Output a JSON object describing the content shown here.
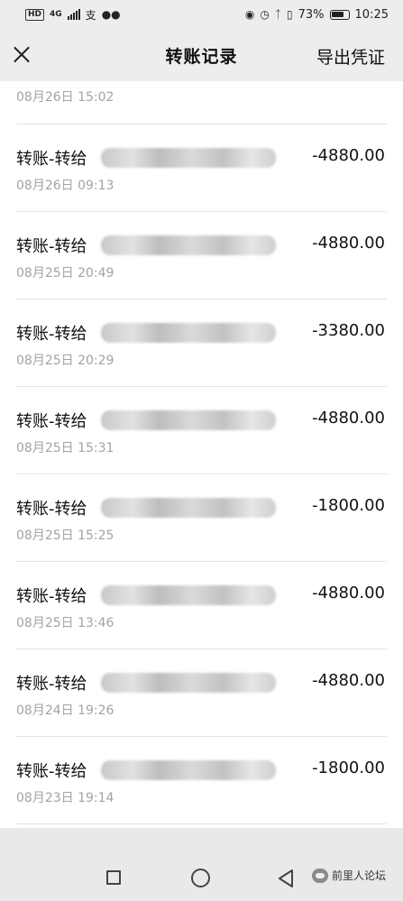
{
  "status_bar": {
    "network": "HD",
    "network_gen": "4G",
    "battery_percent": "73%",
    "time": "10:25",
    "icons": [
      "hd-icon",
      "signal-icon",
      "alipay-icon",
      "wechat-icon",
      "eye-icon",
      "alarm-icon",
      "bluetooth-icon",
      "vibrate-icon",
      "battery-icon"
    ]
  },
  "nav": {
    "title": "转账记录",
    "export_label": "导出凭证",
    "close_icon": "close-icon"
  },
  "transactions": [
    {
      "title": "",
      "time": "08月26日 15:02",
      "amount": ""
    },
    {
      "title": "转账-转给",
      "time": "08月26日 09:13",
      "amount": "-4880.00"
    },
    {
      "title": "转账-转给",
      "time": "08月25日 20:49",
      "amount": "-4880.00"
    },
    {
      "title": "转账-转给",
      "time": "08月25日 20:29",
      "amount": "-3380.00"
    },
    {
      "title": "转账-转给",
      "time": "08月25日 15:31",
      "amount": "-4880.00"
    },
    {
      "title": "转账-转给",
      "time": "08月25日 15:25",
      "amount": "-1800.00"
    },
    {
      "title": "转账-转给",
      "time": "08月25日 13:46",
      "amount": "-4880.00"
    },
    {
      "title": "转账-转给",
      "time": "08月24日 19:26",
      "amount": "-4880.00"
    },
    {
      "title": "转账-转给",
      "time": "08月23日 19:14",
      "amount": "-1800.00"
    }
  ],
  "system_nav": {
    "icons": [
      "recents-square-icon",
      "home-circle-icon",
      "back-triangle-icon"
    ],
    "watermark": "前里人论坛"
  }
}
